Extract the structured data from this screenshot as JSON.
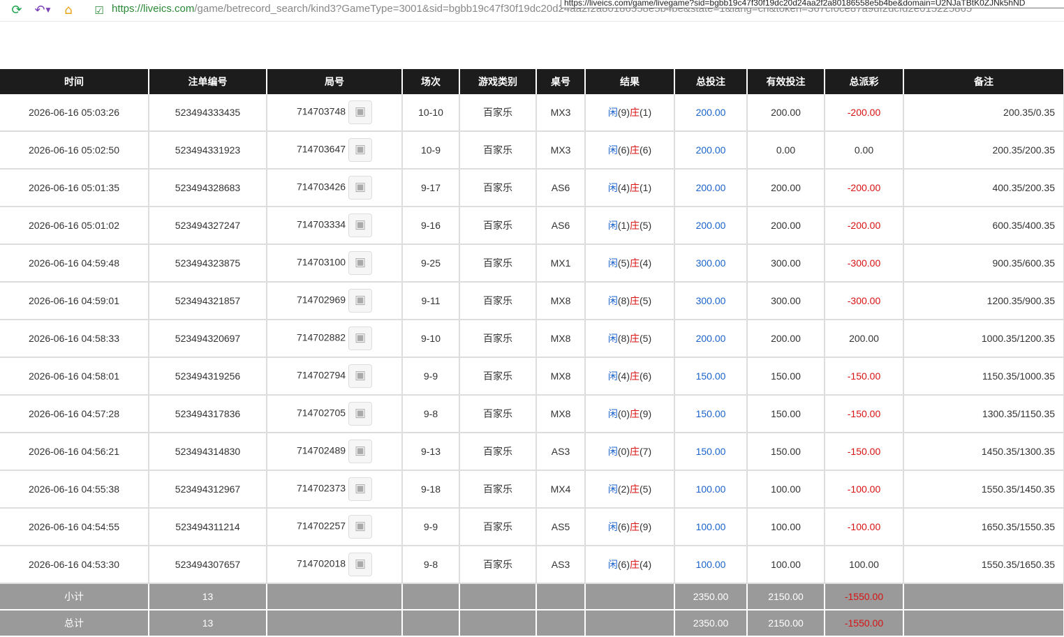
{
  "browser": {
    "url_host": "https://liveics.com",
    "url_path": "/game/betrecord_search/kind3?GameType=3001&sid=bgbb19c47f30f19dc20d24aa2f2a80186558e5b4be&state=1&lang=cn&token=367cf0ce87a9df2dcfd2e015225865",
    "tooltip": "https://liveics.com/game/livegame?sid=bgbb19c47f30f19dc20d24aa2f2a80186558e5b4be&domain=U2NJaTBtK0ZJNk5hND"
  },
  "headers": [
    "时间",
    "注单编号",
    "局号",
    "场次",
    "游戏类别",
    "桌号",
    "结果",
    "总投注",
    "有效投注",
    "总派彩",
    "备注"
  ],
  "result_labels": {
    "player": "闲",
    "banker": "庄"
  },
  "rows": [
    {
      "time": "2026-06-16 05:03:26",
      "bet_id": "523494333435",
      "round": "714703748",
      "session": "10-10",
      "game": "百家乐",
      "table": "MX3",
      "player": "(9)",
      "banker": "(1)",
      "bet": "200.00",
      "valid": "200.00",
      "payout": "-200.00",
      "note": "200.35/0.35"
    },
    {
      "time": "2026-06-16 05:02:50",
      "bet_id": "523494331923",
      "round": "714703647",
      "session": "10-9",
      "game": "百家乐",
      "table": "MX3",
      "player": "(6)",
      "banker": "(6)",
      "bet": "200.00",
      "valid": "0.00",
      "payout": "0.00",
      "note": "200.35/200.35"
    },
    {
      "time": "2026-06-16 05:01:35",
      "bet_id": "523494328683",
      "round": "714703426",
      "session": "9-17",
      "game": "百家乐",
      "table": "AS6",
      "player": "(4)",
      "banker": "(1)",
      "bet": "200.00",
      "valid": "200.00",
      "payout": "-200.00",
      "note": "400.35/200.35"
    },
    {
      "time": "2026-06-16 05:01:02",
      "bet_id": "523494327247",
      "round": "714703334",
      "session": "9-16",
      "game": "百家乐",
      "table": "AS6",
      "player": "(1)",
      "banker": "(5)",
      "bet": "200.00",
      "valid": "200.00",
      "payout": "-200.00",
      "note": "600.35/400.35"
    },
    {
      "time": "2026-06-16 04:59:48",
      "bet_id": "523494323875",
      "round": "714703100",
      "session": "9-25",
      "game": "百家乐",
      "table": "MX1",
      "player": "(5)",
      "banker": "(4)",
      "bet": "300.00",
      "valid": "300.00",
      "payout": "-300.00",
      "note": "900.35/600.35"
    },
    {
      "time": "2026-06-16 04:59:01",
      "bet_id": "523494321857",
      "round": "714702969",
      "session": "9-11",
      "game": "百家乐",
      "table": "MX8",
      "player": "(8)",
      "banker": "(5)",
      "bet": "300.00",
      "valid": "300.00",
      "payout": "-300.00",
      "note": "1200.35/900.35"
    },
    {
      "time": "2026-06-16 04:58:33",
      "bet_id": "523494320697",
      "round": "714702882",
      "session": "9-10",
      "game": "百家乐",
      "table": "MX8",
      "player": "(8)",
      "banker": "(5)",
      "bet": "200.00",
      "valid": "200.00",
      "payout": "200.00",
      "note": "1000.35/1200.35"
    },
    {
      "time": "2026-06-16 04:58:01",
      "bet_id": "523494319256",
      "round": "714702794",
      "session": "9-9",
      "game": "百家乐",
      "table": "MX8",
      "player": "(4)",
      "banker": "(6)",
      "bet": "150.00",
      "valid": "150.00",
      "payout": "-150.00",
      "note": "1150.35/1000.35"
    },
    {
      "time": "2026-06-16 04:57:28",
      "bet_id": "523494317836",
      "round": "714702705",
      "session": "9-8",
      "game": "百家乐",
      "table": "MX8",
      "player": "(0)",
      "banker": "(9)",
      "bet": "150.00",
      "valid": "150.00",
      "payout": "-150.00",
      "note": "1300.35/1150.35"
    },
    {
      "time": "2026-06-16 04:56:21",
      "bet_id": "523494314830",
      "round": "714702489",
      "session": "9-13",
      "game": "百家乐",
      "table": "AS3",
      "player": "(0)",
      "banker": "(7)",
      "bet": "150.00",
      "valid": "150.00",
      "payout": "-150.00",
      "note": "1450.35/1300.35"
    },
    {
      "time": "2026-06-16 04:55:38",
      "bet_id": "523494312967",
      "round": "714702373",
      "session": "9-18",
      "game": "百家乐",
      "table": "MX4",
      "player": "(2)",
      "banker": "(5)",
      "bet": "100.00",
      "valid": "100.00",
      "payout": "-100.00",
      "note": "1550.35/1450.35"
    },
    {
      "time": "2026-06-16 04:54:55",
      "bet_id": "523494311214",
      "round": "714702257",
      "session": "9-9",
      "game": "百家乐",
      "table": "AS5",
      "player": "(6)",
      "banker": "(9)",
      "bet": "100.00",
      "valid": "100.00",
      "payout": "-100.00",
      "note": "1650.35/1550.35"
    },
    {
      "time": "2026-06-16 04:53:30",
      "bet_id": "523494307657",
      "round": "714702018",
      "session": "9-8",
      "game": "百家乐",
      "table": "AS3",
      "player": "(6)",
      "banker": "(4)",
      "bet": "100.00",
      "valid": "100.00",
      "payout": "100.00",
      "note": "1550.35/1650.35"
    }
  ],
  "summary": [
    {
      "label": "小计",
      "count": "13",
      "bet": "2350.00",
      "valid": "2150.00",
      "payout": "-1550.00"
    },
    {
      "label": "总计",
      "count": "13",
      "bet": "2350.00",
      "valid": "2150.00",
      "payout": "-1550.00"
    }
  ],
  "colors": {
    "header_bg": "#1c1c1c",
    "summary_bg": "#9a9a9a",
    "bet_blue": "#1a63cc",
    "loss_red": "#d81111",
    "secure_green": "#2a8a36"
  }
}
